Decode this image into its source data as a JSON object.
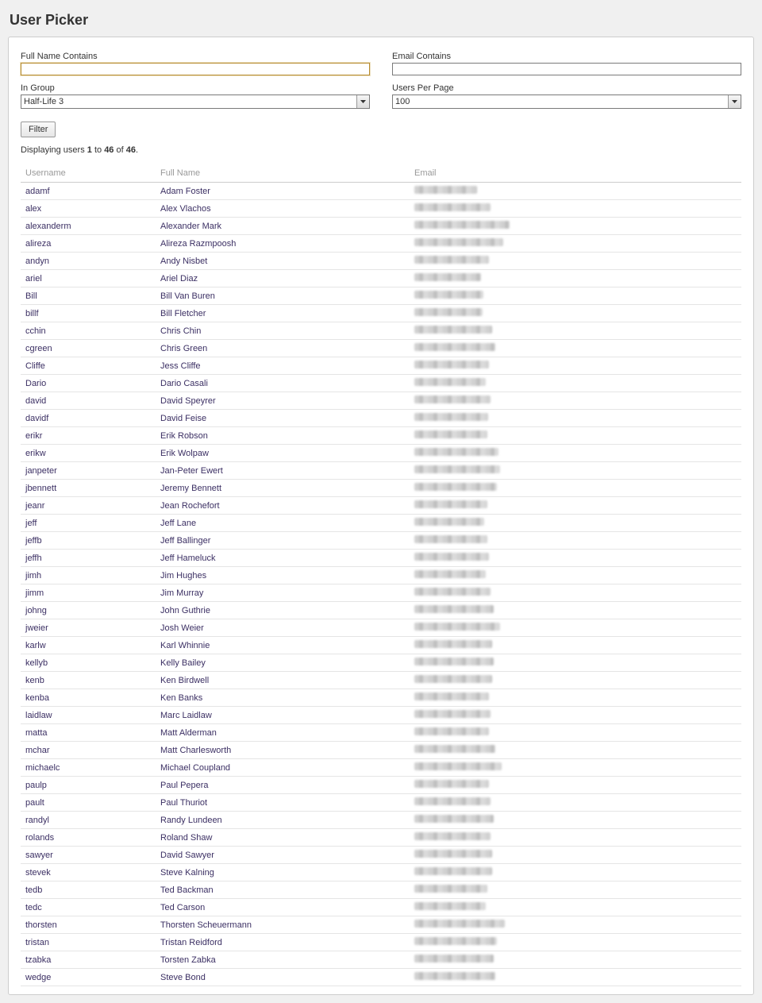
{
  "title": "User Picker",
  "filters": {
    "fullname_label": "Full Name Contains",
    "fullname_value": "",
    "email_label": "Email Contains",
    "email_value": "",
    "group_label": "In Group",
    "group_value": "Half-Life 3",
    "perpage_label": "Users Per Page",
    "perpage_value": "100",
    "button_label": "Filter"
  },
  "summary": {
    "prefix": "Displaying users ",
    "from": "1",
    "mid1": " to ",
    "to": "46",
    "mid2": " of ",
    "total": "46",
    "suffix": "."
  },
  "columns": {
    "username": "Username",
    "fullname": "Full Name",
    "email": "Email"
  },
  "users": [
    {
      "username": "adamf",
      "fullname": "Adam Foster",
      "blur_w": 79
    },
    {
      "username": "alex",
      "fullname": "Alex Vlachos",
      "blur_w": 96
    },
    {
      "username": "alexanderm",
      "fullname": "Alexander Mark",
      "blur_w": 120
    },
    {
      "username": "alireza",
      "fullname": "Alireza Razmpoosh",
      "blur_w": 112
    },
    {
      "username": "andyn",
      "fullname": "Andy Nisbet",
      "blur_w": 94
    },
    {
      "username": "ariel",
      "fullname": "Ariel Diaz",
      "blur_w": 84
    },
    {
      "username": "Bill",
      "fullname": "Bill Van Buren",
      "blur_w": 87
    },
    {
      "username": "billf",
      "fullname": "Bill Fletcher",
      "blur_w": 86
    },
    {
      "username": "cchin",
      "fullname": "Chris Chin",
      "blur_w": 98
    },
    {
      "username": "cgreen",
      "fullname": "Chris Green",
      "blur_w": 102
    },
    {
      "username": "Cliffe",
      "fullname": "Jess Cliffe",
      "blur_w": 94
    },
    {
      "username": "Dario",
      "fullname": "Dario Casali",
      "blur_w": 90
    },
    {
      "username": "david",
      "fullname": "David Speyrer",
      "blur_w": 96
    },
    {
      "username": "davidf",
      "fullname": "David Feise",
      "blur_w": 93
    },
    {
      "username": "erikr",
      "fullname": "Erik Robson",
      "blur_w": 92
    },
    {
      "username": "erikw",
      "fullname": "Erik Wolpaw",
      "blur_w": 106
    },
    {
      "username": "janpeter",
      "fullname": "Jan-Peter Ewert",
      "blur_w": 108
    },
    {
      "username": "jbennett",
      "fullname": "Jeremy Bennett",
      "blur_w": 104
    },
    {
      "username": "jeanr",
      "fullname": "Jean Rochefort",
      "blur_w": 92
    },
    {
      "username": "jeff",
      "fullname": "Jeff Lane",
      "blur_w": 88
    },
    {
      "username": "jeffb",
      "fullname": "Jeff Ballinger",
      "blur_w": 92
    },
    {
      "username": "jeffh",
      "fullname": "Jeff Hameluck",
      "blur_w": 94
    },
    {
      "username": "jimh",
      "fullname": "Jim Hughes",
      "blur_w": 90
    },
    {
      "username": "jimm",
      "fullname": "Jim Murray",
      "blur_w": 96
    },
    {
      "username": "johng",
      "fullname": "John Guthrie",
      "blur_w": 100
    },
    {
      "username": "jweier",
      "fullname": "Josh Weier",
      "blur_w": 108
    },
    {
      "username": "karlw",
      "fullname": "Karl Whinnie",
      "blur_w": 98
    },
    {
      "username": "kellyb",
      "fullname": "Kelly Bailey",
      "blur_w": 100
    },
    {
      "username": "kenb",
      "fullname": "Ken Birdwell",
      "blur_w": 98
    },
    {
      "username": "kenba",
      "fullname": "Ken Banks",
      "blur_w": 94
    },
    {
      "username": "laidlaw",
      "fullname": "Marc Laidlaw",
      "blur_w": 96
    },
    {
      "username": "matta",
      "fullname": "Matt Alderman",
      "blur_w": 94
    },
    {
      "username": "mchar",
      "fullname": "Matt Charlesworth",
      "blur_w": 102
    },
    {
      "username": "michaelc",
      "fullname": "Michael Coupland",
      "blur_w": 110
    },
    {
      "username": "paulp",
      "fullname": "Paul Pepera",
      "blur_w": 94
    },
    {
      "username": "pault",
      "fullname": "Paul Thuriot",
      "blur_w": 96
    },
    {
      "username": "randyl",
      "fullname": "Randy Lundeen",
      "blur_w": 100
    },
    {
      "username": "rolands",
      "fullname": "Roland Shaw",
      "blur_w": 96
    },
    {
      "username": "sawyer",
      "fullname": "David Sawyer",
      "blur_w": 98
    },
    {
      "username": "stevek",
      "fullname": "Steve Kalning",
      "blur_w": 98
    },
    {
      "username": "tedb",
      "fullname": "Ted Backman",
      "blur_w": 92
    },
    {
      "username": "tedc",
      "fullname": "Ted Carson",
      "blur_w": 90
    },
    {
      "username": "thorsten",
      "fullname": "Thorsten Scheuermann",
      "blur_w": 114
    },
    {
      "username": "tristan",
      "fullname": "Tristan Reidford",
      "blur_w": 104
    },
    {
      "username": "tzabka",
      "fullname": "Torsten Zabka",
      "blur_w": 100
    },
    {
      "username": "wedge",
      "fullname": "Steve Bond",
      "blur_w": 102
    }
  ]
}
